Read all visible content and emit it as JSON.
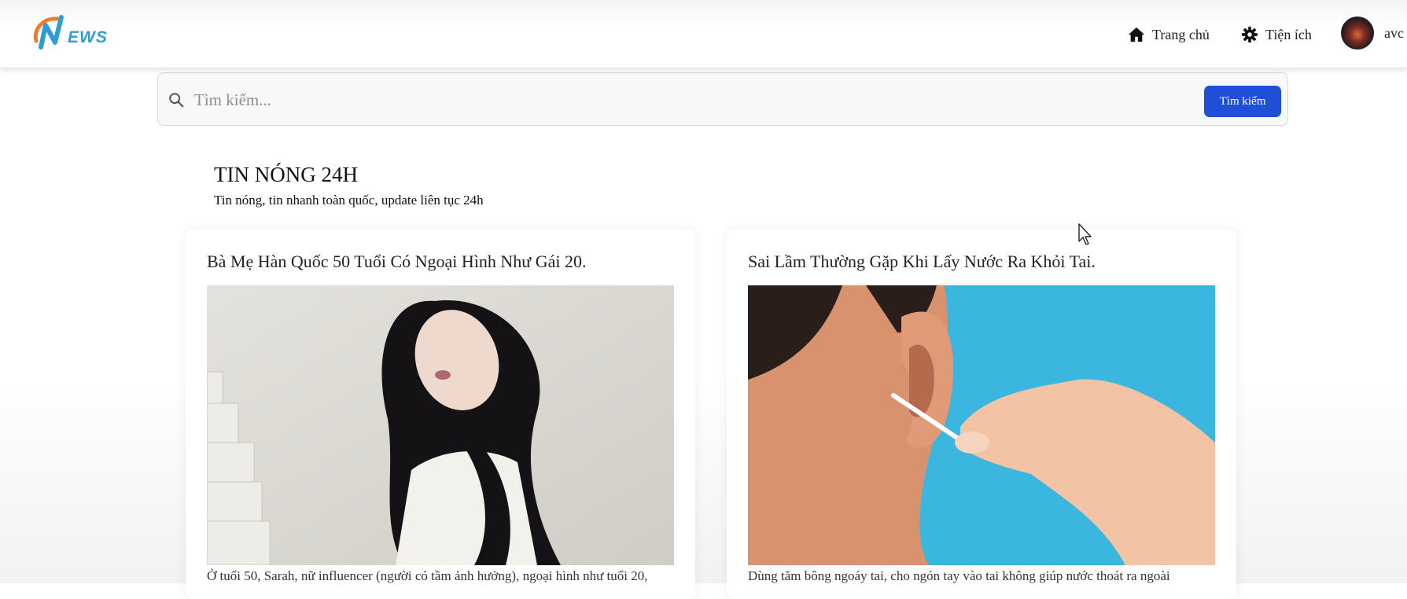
{
  "header": {
    "logo_text": "EWS",
    "nav": [
      {
        "label": "Trang chủ",
        "icon": "home-icon"
      },
      {
        "label": "Tiện ích",
        "icon": "gear-icon"
      }
    ],
    "user": {
      "name": "avc"
    }
  },
  "search": {
    "placeholder": "Tìm kiếm...",
    "value": "",
    "button_label": "Tìm kiếm"
  },
  "section": {
    "title": "TIN NÓNG 24H",
    "subtitle": "Tin nóng, tin nhanh toàn quốc, update liên tục 24h"
  },
  "articles": [
    {
      "title": "Bà Mẹ Hàn Quốc 50 Tuổi Có Ngoại Hình Như Gái 20.",
      "excerpt": "Ở tuổi 50, Sarah, nữ influencer (người có tầm ảnh hưởng), ngoại hình như tuổi 20,"
    },
    {
      "title": "Sai Lầm Thường Gặp Khi Lấy Nước Ra Khỏi Tai.",
      "excerpt": "Dùng tăm bông ngoáy tai, cho ngón tay vào tai không giúp nước thoát ra ngoài"
    }
  ],
  "colors": {
    "primary_button": "#1f4fd6",
    "logo_blue": "#2b9ed8",
    "logo_orange": "#f47a2b"
  }
}
